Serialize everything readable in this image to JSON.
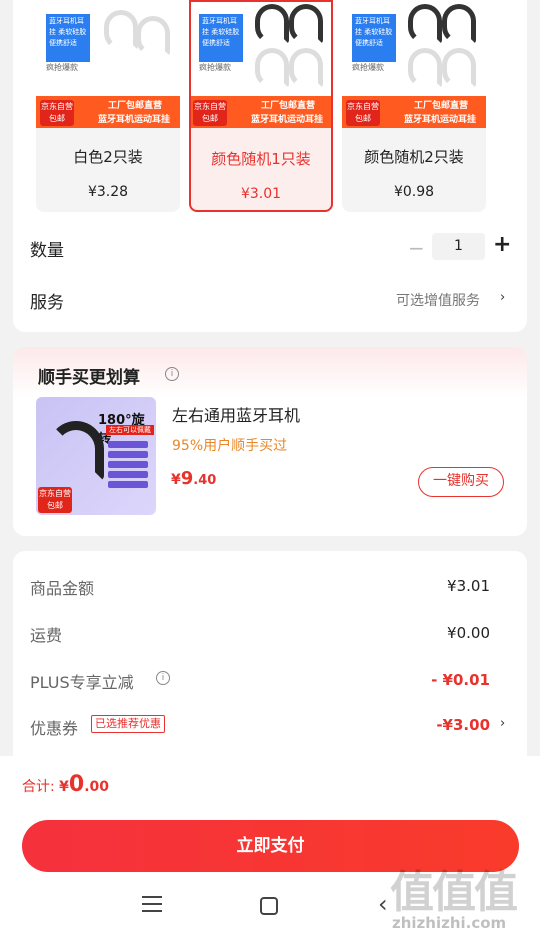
{
  "variants": [
    {
      "name": "白色2只装",
      "price": "¥3.28",
      "thumb_tag": "蓝牙耳机耳挂 柔软硅胶 便携舒适",
      "thumb_hot": "疯抢爆款",
      "banner_1": "工厂包邮直营",
      "banner_2": "蓝牙耳机运动耳挂",
      "jd_badge": "京东自营 包邮"
    },
    {
      "name": "颜色随机1只装",
      "price": "¥3.01",
      "thumb_tag": "蓝牙耳机耳挂 柔软硅胶 便携舒适",
      "thumb_hot": "疯抢爆款",
      "banner_1": "工厂包邮直营",
      "banner_2": "蓝牙耳机运动耳挂",
      "jd_badge": "京东自营 包邮"
    },
    {
      "name": "颜色随机2只装",
      "price": "¥0.98",
      "thumb_tag": "蓝牙耳机耳挂 柔软硅胶 便携舒适",
      "thumb_hot": "疯抢爆款",
      "banner_1": "工厂包邮直营",
      "banner_2": "蓝牙耳机运动耳挂",
      "jd_badge": "京东自营 包邮"
    }
  ],
  "selected_variant": "颜色随机1只装",
  "quantity": {
    "label": "数量",
    "minus": "−",
    "value": "1",
    "plus": "+"
  },
  "service": {
    "label": "服务",
    "value": "可选增值服务",
    "chevron": "›"
  },
  "bundle": {
    "title": "顺手买更划算",
    "info": "i",
    "product_name": "左右通用蓝牙耳机",
    "subtitle": "95%用户顺手买过",
    "price_currency": "¥",
    "price_int": "9",
    "price_dec": ".40",
    "buy_label": "一键购买",
    "img_text_1": "180°旋转",
    "img_text_2": "左右可以佩戴",
    "jd_badge": "京东自营 包邮"
  },
  "summary": {
    "rows": [
      {
        "label": "商品金额",
        "value": "¥3.01"
      },
      {
        "label": "运费",
        "value": "¥0.00"
      },
      {
        "label": "PLUS专享立减",
        "value": "- ¥0.01"
      },
      {
        "label": "优惠券",
        "value": "-¥3.00"
      }
    ],
    "coupon_tag": "已选推荐优惠",
    "coupon_chevron": "›",
    "plus_info": "i"
  },
  "bottom": {
    "total_label": "合计: ",
    "total_currency": "¥",
    "total_int": "0",
    "total_dec": ".00",
    "pay_label": "立即支付"
  },
  "nav": {
    "back": "‹"
  },
  "watermark": {
    "main": "值值值",
    "sub": "zhizhizhi.com"
  },
  "colors": {
    "accent": "#e8322d",
    "orange": "#ff5a1f",
    "subtitle_orange": "#e8882a"
  }
}
